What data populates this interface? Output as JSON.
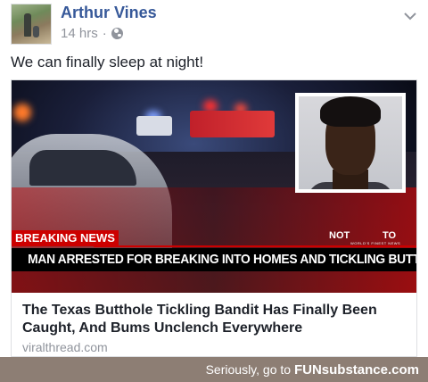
{
  "post": {
    "author": "Arthur Vines",
    "time": "14 hrs",
    "separator": "·",
    "status": "We can finally sleep at night!"
  },
  "card": {
    "image_overlay": {
      "breaking_label": "BREAKING NEWS",
      "network_logo_left": "NOT",
      "network_logo_right": "TO",
      "network_tagline": "WORLD'S FINEST NEWS",
      "headline": "MAN ARRESTED FOR BREAKING INTO HOMES AND TICKLING BUTTHOLES"
    },
    "title": "The Texas Butthole Tickling Bandit Has Finally Been Caught, And Bums Unclench Everywhere",
    "domain": "viralthread.com"
  },
  "footer": {
    "prefix": "Seriously, go to ",
    "brand": "FUNsubstance.com"
  },
  "colors": {
    "author_link": "#365899",
    "meta_gray": "#90949c",
    "breaking_red": "#cc0000",
    "footer_bg": "#8d7e74"
  }
}
